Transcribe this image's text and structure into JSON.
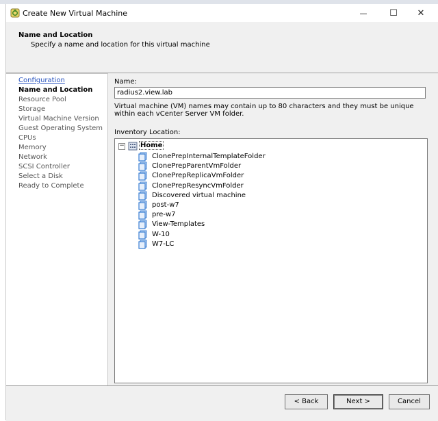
{
  "window": {
    "title": "Create New Virtual Machine",
    "minimize_glyph": "—",
    "maximize_glyph": "☐",
    "close_glyph": "✕"
  },
  "header": {
    "title": "Name and Location",
    "subtitle": "Specify a name and location for this virtual machine"
  },
  "nav": {
    "items": [
      {
        "label": "Configuration",
        "state": "link"
      },
      {
        "label": "Name and Location",
        "state": "current"
      },
      {
        "label": "Resource Pool",
        "state": "pending"
      },
      {
        "label": "Storage",
        "state": "pending"
      },
      {
        "label": "Virtual Machine Version",
        "state": "pending"
      },
      {
        "label": "Guest Operating System",
        "state": "pending"
      },
      {
        "label": "CPUs",
        "state": "pending"
      },
      {
        "label": "Memory",
        "state": "pending"
      },
      {
        "label": "Network",
        "state": "pending"
      },
      {
        "label": "SCSI Controller",
        "state": "pending"
      },
      {
        "label": "Select a Disk",
        "state": "pending"
      },
      {
        "label": "Ready to Complete",
        "state": "pending"
      }
    ]
  },
  "form": {
    "name_label": "Name:",
    "name_value": "radius2.view.lab",
    "help_text": "Virtual machine (VM) names may contain up to 80 characters and they must be unique within each vCenter Server VM folder.",
    "inventory_label": "Inventory Location:"
  },
  "tree": {
    "toggle": "−",
    "root": "Home",
    "folders": [
      "ClonePrepInternalTemplateFolder",
      "ClonePrepParentVmFolder",
      "ClonePrepReplicaVmFolder",
      "ClonePrepResyncVmFolder",
      "Discovered virtual machine",
      "post-w7",
      "pre-w7",
      "View-Templates",
      "W-10",
      "W7-LC"
    ]
  },
  "footer": {
    "back_label": "< Back",
    "next_label": "Next >",
    "cancel_label": "Cancel"
  },
  "icons": {
    "app": "vm-wizard-icon",
    "home": "datacenter-icon",
    "folder": "folder-icon"
  },
  "colors": {
    "link": "#2a55c0",
    "folder": "#3b7fd4",
    "panel": "#f0f0f0"
  }
}
